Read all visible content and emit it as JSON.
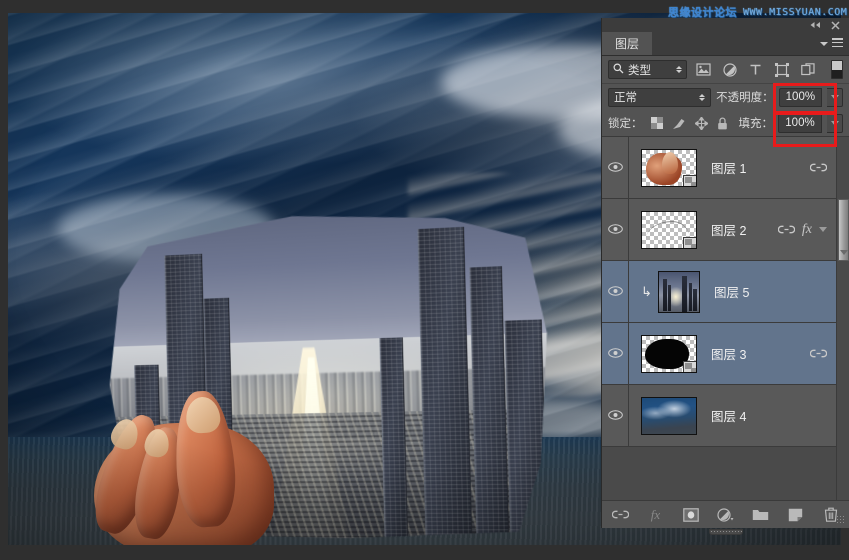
{
  "watermark": {
    "cn": "思缘设计论坛",
    "url": "WWW.MISSYUAN.COM"
  },
  "panel": {
    "tab_label": "图层",
    "titlebar": {
      "collapse_icon": "double-left-arrows-icon",
      "close_icon": "close-icon"
    },
    "menu_icon": "panel-menu-icon",
    "filter": {
      "search_icon": "search-icon",
      "kind_label": "类型",
      "icons": [
        "pixel-layer-filter-icon",
        "adjustment-layer-filter-icon",
        "type-layer-filter-icon",
        "shape-layer-filter-icon",
        "smart-object-filter-icon"
      ],
      "toggle_icon": "filter-toggle-switch"
    },
    "blend": {
      "mode_label": "正常",
      "opacity_label": "不透明度：",
      "opacity_value": "100%",
      "fill_label": "填充：",
      "fill_value": "100%"
    },
    "lock": {
      "label": "锁定：",
      "icons": [
        "lock-transparency-icon",
        "lock-image-pixels-icon",
        "lock-position-icon",
        "lock-all-icon"
      ]
    },
    "layers": [
      {
        "name": "图层 1",
        "visible": true,
        "selected": false,
        "thumb": "hand-cutout",
        "has_link": true,
        "has_fx": false,
        "clipped": false,
        "has_smart_badge": true
      },
      {
        "name": "图层 2",
        "visible": true,
        "selected": false,
        "thumb": "empty-transparent",
        "has_link": true,
        "has_fx": true,
        "clipped": false,
        "has_smart_badge": true
      },
      {
        "name": "图层 5",
        "visible": true,
        "selected": true,
        "thumb": "night-city-square",
        "has_link": false,
        "has_fx": false,
        "clipped": true,
        "has_smart_badge": false
      },
      {
        "name": "图层 3",
        "visible": true,
        "selected": true,
        "thumb": "black-shape-mask",
        "has_link": true,
        "has_fx": false,
        "clipped": false,
        "has_smart_badge": true
      },
      {
        "name": "图层 4",
        "visible": true,
        "selected": false,
        "thumb": "sky-ocean-photo",
        "has_link": false,
        "has_fx": false,
        "clipped": false,
        "has_smart_badge": false
      }
    ],
    "bottom_icons": [
      "link-layers-icon",
      "add-layer-style-icon",
      "add-layer-mask-icon",
      "new-adjustment-layer-icon",
      "new-group-icon",
      "new-layer-icon",
      "delete-layer-icon"
    ]
  },
  "colors": {
    "panel_bg": "#535353",
    "list_bg": "#595959",
    "selected_row": "#62748c",
    "annotation_red": "#e81b1b",
    "text": "#e0e0e0"
  }
}
